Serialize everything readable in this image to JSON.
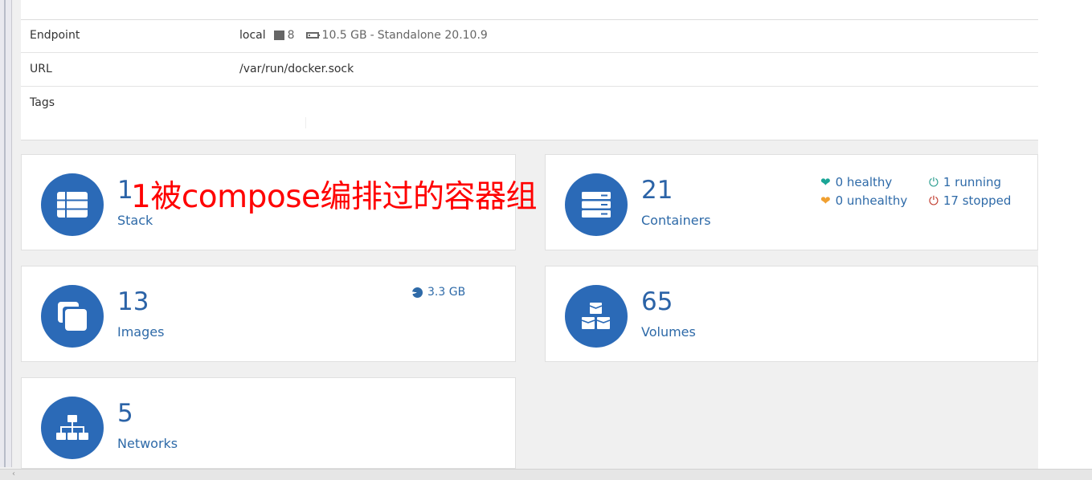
{
  "endpoint_info": {
    "endpoint": {
      "label": "Endpoint",
      "name": "local",
      "cpu_count": "8",
      "memory": "10.5 GB",
      "separator": "-",
      "mode": "Standalone 20.10.9"
    },
    "url": {
      "label": "URL",
      "value": "/var/run/docker.sock"
    },
    "tags": {
      "label": "Tags",
      "value": ""
    }
  },
  "annotation": "1被compose编排过的容器组",
  "cards": {
    "stack": {
      "count": "1",
      "label": "Stack"
    },
    "containers": {
      "count": "21",
      "label": "Containers",
      "healthy": "0 healthy",
      "unhealthy": "0 unhealthy",
      "running": "1 running",
      "stopped": "17 stopped"
    },
    "images": {
      "count": "13",
      "label": "Images",
      "size": "3.3 GB"
    },
    "volumes": {
      "count": "65",
      "label": "Volumes"
    },
    "networks": {
      "count": "5",
      "label": "Networks"
    }
  },
  "colors": {
    "accent": "#2b6ab7",
    "healthy": "#1aa596",
    "unhealthy": "#f0a030",
    "running": "#2a9d8f",
    "stopped": "#c0392b",
    "annotation": "#ff0000"
  }
}
